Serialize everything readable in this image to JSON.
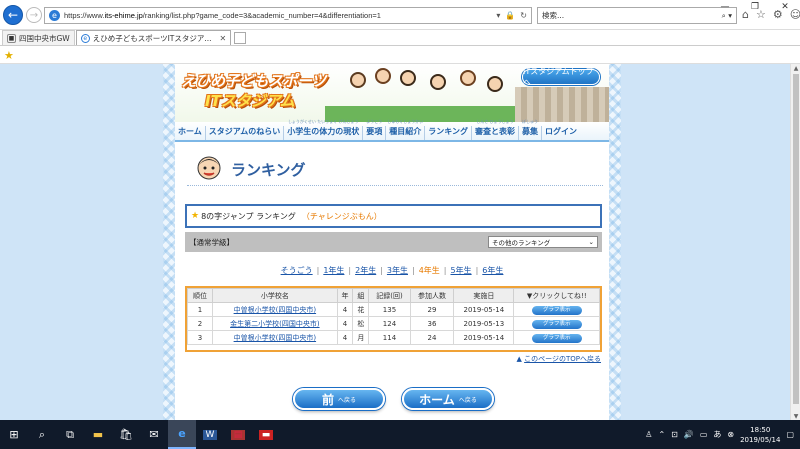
{
  "browser": {
    "url_prefix": "https://www.",
    "url_host": "its-ehime.jp",
    "url_path": "/ranking/list.php?game_code=3&academic_number=4&differentiation=1",
    "search_placeholder": "検索...",
    "tabs": [
      {
        "label": "四国中央市GW"
      },
      {
        "label": "えひめ子どもスポーツITスタジア..."
      }
    ]
  },
  "site": {
    "logo_line1": "えひめ子どもスポーツ",
    "logo_line2": "ITスタジアム",
    "top_button": "ITスタジアムトップへ",
    "menu": [
      {
        "label": "ホーム",
        "ruby": ""
      },
      {
        "label": "スタジアムのねらい",
        "ruby": ""
      },
      {
        "label": "小学生の体力の現状",
        "ruby": "しょうがくせい たいりょく げんじょう"
      },
      {
        "label": "要項",
        "ruby": "ようこう"
      },
      {
        "label": "種目紹介",
        "ruby": "しゅもくしょうかい"
      },
      {
        "label": "ランキング",
        "ruby": ""
      },
      {
        "label": "審査と表彰",
        "ruby": "しんさ ひょうしょう"
      },
      {
        "label": "募集",
        "ruby": "ぼしゅう"
      },
      {
        "label": "ログイン",
        "ruby": ""
      }
    ]
  },
  "ranking": {
    "title": "ランキング",
    "event": "8の字ジャンプ ランキング",
    "event_tag": "（チャレンジぶもん）",
    "category": "【通常学級】",
    "other_select": "その他のランキング",
    "grades": [
      {
        "label": "そうごう",
        "selected": false
      },
      {
        "label": "1年生",
        "selected": false
      },
      {
        "label": "2年生",
        "selected": false
      },
      {
        "label": "3年生",
        "selected": false
      },
      {
        "label": "4年生",
        "selected": true
      },
      {
        "label": "5年生",
        "selected": false
      },
      {
        "label": "6年生",
        "selected": false
      }
    ],
    "columns": [
      "順位",
      "小学校名",
      "年",
      "組",
      "記録(回)",
      "参加人数",
      "実施日",
      "▼クリックしてね!!"
    ],
    "rows": [
      {
        "rank": "1",
        "school": "中曽根小学校(四国中央市)",
        "grade": "4",
        "class": "花",
        "record": "135",
        "participants": "29",
        "date": "2019-05-14",
        "button": "グラフ表示"
      },
      {
        "rank": "2",
        "school": "金生第二小学校(四国中央市)",
        "grade": "4",
        "class": "松",
        "record": "124",
        "participants": "36",
        "date": "2019-05-13",
        "button": "グラフ表示"
      },
      {
        "rank": "3",
        "school": "中曽根小学校(四国中央市)",
        "grade": "4",
        "class": "月",
        "record": "114",
        "participants": "24",
        "date": "2019-05-14",
        "button": "グラフ表示"
      }
    ],
    "to_top": "このページのTOPへ戻る",
    "back_button": {
      "big": "前",
      "small": "へ戻る"
    },
    "home_button": {
      "big": "ホーム",
      "small": "へ戻る"
    }
  },
  "taskbar": {
    "time": "18:50",
    "date": "2019/05/14",
    "ime": "あ"
  }
}
